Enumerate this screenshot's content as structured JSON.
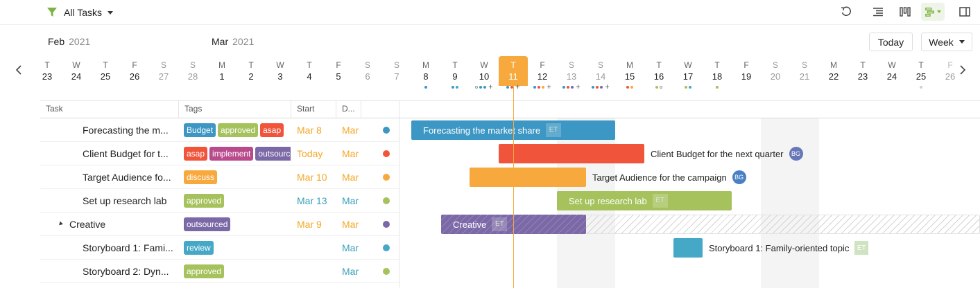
{
  "toolbar": {
    "filter_label": "All Tasks",
    "accent": "#7cb342"
  },
  "timeline": {
    "months": [
      {
        "name": "Feb",
        "year": "2021"
      },
      {
        "name": "Mar",
        "year": "2021"
      }
    ],
    "today_label": "Today",
    "view_label": "Week",
    "days": [
      {
        "dw": "T",
        "dn": "23"
      },
      {
        "dw": "W",
        "dn": "24"
      },
      {
        "dw": "T",
        "dn": "25"
      },
      {
        "dw": "F",
        "dn": "26"
      },
      {
        "dw": "S",
        "dn": "27"
      },
      {
        "dw": "S",
        "dn": "28"
      },
      {
        "dw": "M",
        "dn": "1"
      },
      {
        "dw": "T",
        "dn": "2"
      },
      {
        "dw": "W",
        "dn": "3"
      },
      {
        "dw": "T",
        "dn": "4"
      },
      {
        "dw": "F",
        "dn": "5"
      },
      {
        "dw": "S",
        "dn": "6"
      },
      {
        "dw": "S",
        "dn": "7"
      },
      {
        "dw": "M",
        "dn": "8"
      },
      {
        "dw": "T",
        "dn": "9"
      },
      {
        "dw": "W",
        "dn": "10"
      },
      {
        "dw": "T",
        "dn": "11"
      },
      {
        "dw": "F",
        "dn": "12"
      },
      {
        "dw": "S",
        "dn": "13"
      },
      {
        "dw": "S",
        "dn": "14"
      },
      {
        "dw": "M",
        "dn": "15"
      },
      {
        "dw": "T",
        "dn": "16"
      },
      {
        "dw": "W",
        "dn": "17"
      },
      {
        "dw": "T",
        "dn": "18"
      },
      {
        "dw": "F",
        "dn": "19"
      },
      {
        "dw": "S",
        "dn": "20"
      },
      {
        "dw": "S",
        "dn": "21"
      },
      {
        "dw": "M",
        "dn": "22"
      },
      {
        "dw": "T",
        "dn": "23"
      },
      {
        "dw": "W",
        "dn": "24"
      },
      {
        "dw": "T",
        "dn": "25"
      },
      {
        "dw": "F",
        "dn": "26"
      }
    ]
  },
  "grid": {
    "headers": {
      "task": "Task",
      "tags": "Tags",
      "start": "Start",
      "duration": "D..."
    },
    "rows": [
      {
        "name": "Forecasting the m...",
        "indent": 2,
        "tags": [
          {
            "t": "Budget",
            "c": "#3d97c4"
          },
          {
            "t": "approved",
            "c": "#a5c25c"
          },
          {
            "t": "asap",
            "c": "#f0553c"
          }
        ],
        "start": "Mar 8",
        "start_color": "#f5a623",
        "dur": "Mar",
        "dur_color": "#f5a623",
        "status": "#3d97c4"
      },
      {
        "name": "Client Budget for t...",
        "indent": 2,
        "tags": [
          {
            "t": "asap",
            "c": "#f0553c"
          },
          {
            "t": "implement",
            "c": "#b94a8c"
          },
          {
            "t": "outsourced",
            "c": "#7b68a6"
          }
        ],
        "start": "Today",
        "start_color": "#f5a623",
        "dur": "Mar",
        "dur_color": "#f5a623",
        "status": "#f0553c"
      },
      {
        "name": "Target Audience fo...",
        "indent": 2,
        "tags": [
          {
            "t": "discuss",
            "c": "#f8a93e"
          }
        ],
        "start": "Mar 10",
        "start_color": "#f5a623",
        "dur": "Mar",
        "dur_color": "#f5a623",
        "status": "#f8a93e"
      },
      {
        "name": "Set up research lab",
        "indent": 2,
        "tags": [
          {
            "t": "approved",
            "c": "#a5c25c"
          }
        ],
        "start": "Mar 13",
        "start_color": "#3aa0b8",
        "dur": "Mar",
        "dur_color": "#3aa0b8",
        "status": "#a5c25c"
      },
      {
        "name": "Creative",
        "indent": 1,
        "group": true,
        "tags": [
          {
            "t": "outsourced",
            "c": "#7b68a6"
          }
        ],
        "start": "Mar 9",
        "start_color": "#f5a623",
        "dur": "Mar",
        "dur_color": "#f5a623",
        "status": "#7b68a6"
      },
      {
        "name": "Storyboard 1: Fami...",
        "indent": 2,
        "tags": [
          {
            "t": "review",
            "c": "#45a8c6"
          }
        ],
        "start": "",
        "start_color": "#3aa0b8",
        "dur": "Mar",
        "dur_color": "#3aa0b8",
        "status": "#45a8c6"
      },
      {
        "name": "Storyboard 2: Dyn...",
        "indent": 2,
        "tags": [
          {
            "t": "approved",
            "c": "#a5c25c"
          }
        ],
        "start": "",
        "start_color": "#3aa0b8",
        "dur": "Mar",
        "dur_color": "#3aa0b8",
        "status": "#a5c25c"
      }
    ]
  },
  "bars": [
    {
      "label": "Forecasting the market share",
      "color": "#3d97c4",
      "inside": true,
      "badge": "ET"
    },
    {
      "label": "Client Budget for the next quarter",
      "color": "#f0553c",
      "inside": false,
      "avatar": "BG",
      "avatar_color": "#6777b8"
    },
    {
      "label": "Target Audience for the campaign",
      "color": "#f8a93e",
      "inside": false,
      "avatar": "BG",
      "avatar_color": "#4a7fc4"
    },
    {
      "label": "Set up research lab",
      "color": "#a5c25c",
      "inside": true,
      "badge": "ET"
    },
    {
      "label": "Creative",
      "color": "#7b68a6",
      "inside": true,
      "badge": "ET"
    },
    {
      "label": "Storyboard 1: Family-oriented topic",
      "color": "#45a8c6",
      "inside": false,
      "badge": "ET"
    }
  ]
}
